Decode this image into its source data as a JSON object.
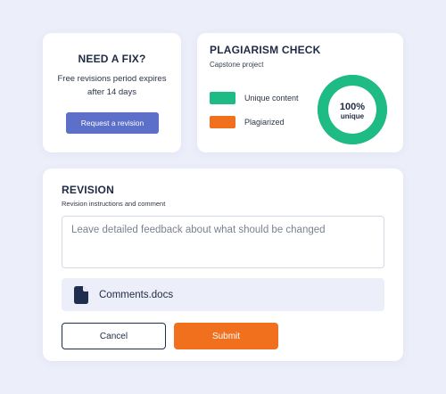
{
  "fix_card": {
    "title": "NEED A FIX?",
    "description": "Free revisions period expires after 14 days",
    "button_label": "Request a revision"
  },
  "plagiarism_card": {
    "title": "PLAGIARISM CHECK",
    "subtitle": "Capstone project",
    "legend": [
      {
        "label": "Unique content",
        "color": "#1fbb84"
      },
      {
        "label": "Plagiarized",
        "color": "#f0701e"
      }
    ],
    "donut": {
      "percent_label": "100%",
      "caption": "unique",
      "unique_fraction": 1.0,
      "plagiarized_fraction": 0.0
    }
  },
  "revision_card": {
    "title": "REVISION",
    "subtitle": "Revision instructions and comment",
    "feedback_placeholder": "Leave detailed feedback about what should be changed",
    "attachment_name": "Comments.docs",
    "attachment_icon": "file-icon",
    "cancel_label": "Cancel",
    "submit_label": "Submit"
  },
  "colors": {
    "background": "#eceffa",
    "primary_button": "#5c6fc9",
    "accent_orange": "#f0701e",
    "unique_green": "#1fbb84",
    "navy": "#1f2e4f"
  }
}
